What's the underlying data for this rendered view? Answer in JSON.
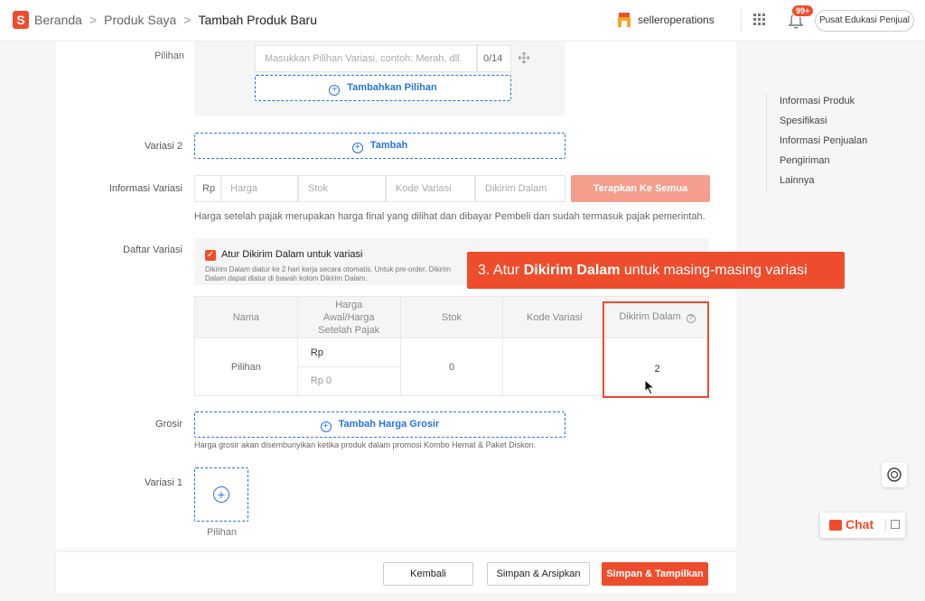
{
  "breadcrumb": {
    "home": "Beranda",
    "products": "Produk Saya",
    "current": "Tambah Produk Baru",
    "separator": ">"
  },
  "header": {
    "shop_name": "selleroperations",
    "notification_badge": "99+",
    "edu_button": "Pusat Edukasi Penjual"
  },
  "variation_option": {
    "label": "Pilihan",
    "placeholder": "Masukkan Pilihan Variasi, contoh: Merah, dll.",
    "counter": "0/14",
    "add_option": "Tambahkan Pilihan"
  },
  "variation2": {
    "label": "Variasi 2",
    "add_button": "Tambah"
  },
  "variation_info": {
    "label": "Informasi Variasi",
    "currency": "Rp",
    "price_placeholder": "Harga",
    "stock_placeholder": "Stok",
    "code_placeholder": "Kode Variasi",
    "preorder_placeholder": "Dikirim Dalam",
    "apply_all": "Terapkan Ke Semua",
    "hint": "Harga setelah pajak merupakan harga final yang dilihat dan dibayar Pembeli dan sudah termasuk pajak pemerintah."
  },
  "variation_list": {
    "label": "Daftar Variasi",
    "checkbox_label": "Atur Dikirim Dalam untuk variasi",
    "note": "Dikirim Dalam diatur ke 2 hari kerja secara otomatis. Untuk pre-order, Dikirim Dalam dapat diatur di bawah kolom Dikirim Dalam.",
    "columns": [
      "Nama",
      "Harga Awal/Harga Setelah Pajak",
      "Stok",
      "Kode Variasi",
      "Dikirim Dalam"
    ],
    "row": {
      "name": "Pilihan",
      "price_top": "Rp",
      "price_bottom": "Rp  0",
      "stock": "0",
      "code": "",
      "ship_days": "2"
    }
  },
  "callout": {
    "prefix": "3. Atur ",
    "bold": "Dikirim Dalam",
    "suffix": " untuk masing-masing variasi"
  },
  "wholesale": {
    "label": "Grosir",
    "add_button": "Tambah Harga Grosir",
    "hint": "Harga grosir akan disembunyikan ketika produk dalam promosi Kombo Hemat & Paket Diskon."
  },
  "variation1": {
    "label": "Variasi 1",
    "image_caption": "Pilihan"
  },
  "footer": {
    "back": "Kembali",
    "save_archive": "Simpan & Arsipkan",
    "save_show": "Simpan & Tampilkan"
  },
  "side_nav": [
    "Informasi Produk",
    "Spesifikasi",
    "Informasi Penjualan",
    "Pengiriman",
    "Lainnya"
  ],
  "chat": {
    "label": "Chat"
  },
  "colors": {
    "brand": "#ee4d2d",
    "link": "#2673dd"
  }
}
